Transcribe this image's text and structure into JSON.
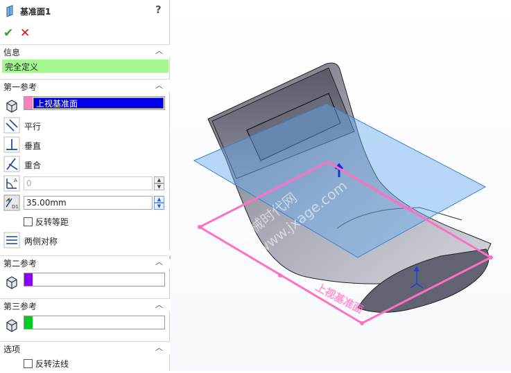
{
  "panel": {
    "title": "基准面1",
    "help": "?",
    "ok": "✔",
    "cancel": "✕",
    "info": {
      "header": "信息",
      "status": "完全定义"
    },
    "first_ref": {
      "header": "第一参考",
      "selection": "上视基准面",
      "parallel": "平行",
      "perpendicular": "垂直",
      "coincident": "重合",
      "angle_value": "0",
      "offset_value": "35.00mm",
      "flip_offset": "反转等距",
      "symmetric": "两侧对称"
    },
    "second_ref": {
      "header": "第二参考"
    },
    "third_ref": {
      "header": "第三参考"
    },
    "options": {
      "header": "选项",
      "flip_normal": "反转法线"
    }
  },
  "viewport": {
    "plane_label": "上视基准面",
    "watermark_1": "机械时代网",
    "watermark_2": "www.jxage.com"
  },
  "colors": {
    "status_bg": "#a2f78e",
    "selection_bg": "#0000e6",
    "swatch_first": "#ff7ec0",
    "swatch_second": "#8b00ff",
    "swatch_third": "#00cc22",
    "plane_edge": "#ff6fc4"
  }
}
